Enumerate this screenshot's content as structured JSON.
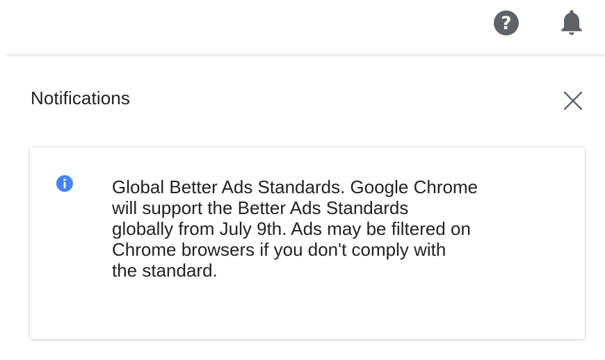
{
  "header": {
    "help_icon": "help-circle-icon",
    "help_glyph": "?",
    "notifications_icon": "bell-icon"
  },
  "panel": {
    "title": "Notifications",
    "close_icon": "close-icon"
  },
  "notification": {
    "icon": "info-icon",
    "icon_color": "#4285f4",
    "lines": [
      "Global Better Ads Standards. Google Chrome",
      "will support the Better Ads Standards",
      "globally from July 9th. Ads may be filtered on",
      "Chrome browsers if you don't comply with",
      "the standard."
    ]
  },
  "colors": {
    "icon_gray": "#5f6368",
    "text": "#222222",
    "accent_blue": "#4285f4"
  }
}
